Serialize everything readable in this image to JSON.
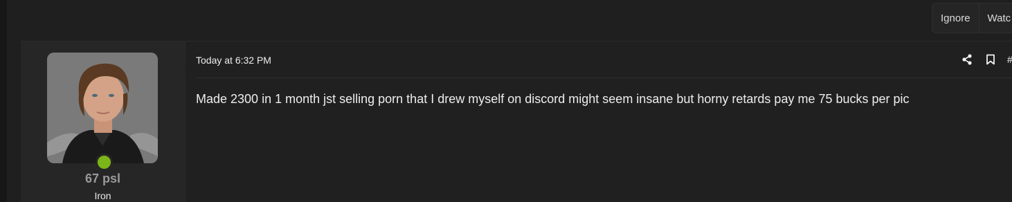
{
  "thread_actions": {
    "ignore_label": "Ignore",
    "watch_label": "Watc"
  },
  "post": {
    "author": {
      "username": "67 psl",
      "user_title": "Iron",
      "online": true,
      "online_color": "#7cb518"
    },
    "timestamp": "Today at 6:32 PM",
    "post_number": "#",
    "tools": {
      "share_icon": "share-icon",
      "bookmark_icon": "bookmark-icon"
    },
    "message": "Made 2300 in 1 month jst selling porn that I drew myself on discord might seem insane but horny retards pay me 75 bucks per pic"
  }
}
